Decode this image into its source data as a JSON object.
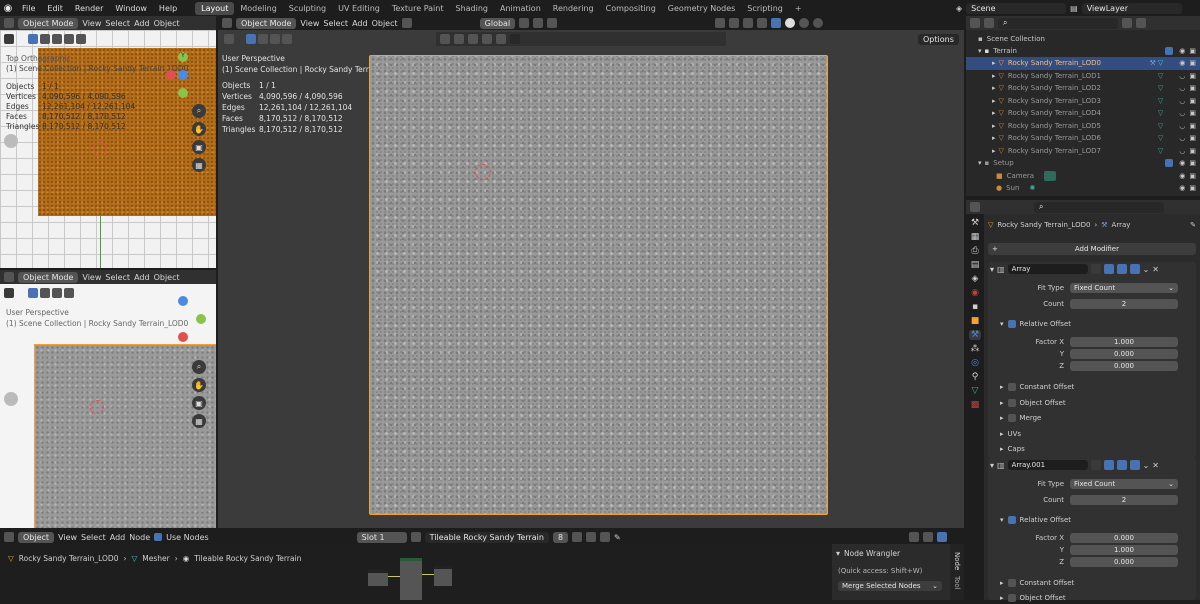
{
  "menu": {
    "items": [
      "File",
      "Edit",
      "Render",
      "Window",
      "Help"
    ]
  },
  "workspaces": [
    "Layout",
    "Modeling",
    "Sculpting",
    "UV Editing",
    "Texture Paint",
    "Shading",
    "Animation",
    "Rendering",
    "Compositing",
    "Geometry Nodes",
    "Scripting"
  ],
  "active_workspace": "Layout",
  "top_right": {
    "scene": "Scene",
    "view_layer": "ViewLayer"
  },
  "left_top": {
    "mode": "Object Mode",
    "menus": [
      "View",
      "Select",
      "Add",
      "Object"
    ],
    "overlay_title": "Top Orthographic",
    "overlay_collection": "(1) Scene Collection | Rocky Sandy Terrain_LOD0",
    "stats": [
      [
        "Objects",
        "1 / 1"
      ],
      [
        "Vertices",
        "4,090,596 / 4,090,596"
      ],
      [
        "Edges",
        "12,261,104 / 12,261,104"
      ],
      [
        "Faces",
        "8,170,512 / 8,170,512"
      ],
      [
        "Triangles",
        "8,170,512 / 8,170,512"
      ]
    ]
  },
  "left_bottom": {
    "mode": "Object Mode",
    "menus": [
      "View",
      "Select",
      "Add",
      "Object"
    ],
    "overlay_title": "User Perspective",
    "overlay_collection": "(1) Scene Collection | Rocky Sandy Terrain_LOD0"
  },
  "main_vp": {
    "mode": "Object Mode",
    "menus": [
      "View",
      "Select",
      "Add",
      "Object"
    ],
    "orientation": "Global",
    "overlay_title": "User Perspective",
    "overlay_collection": "(1) Scene Collection | Rocky Sandy Terrain_LOD0",
    "stats": [
      [
        "Objects",
        "1 / 1"
      ],
      [
        "Vertices",
        "4,090,596 / 4,090,596"
      ],
      [
        "Edges",
        "12,261,104 / 12,261,104"
      ],
      [
        "Faces",
        "8,170,512 / 8,170,512"
      ],
      [
        "Triangles",
        "8,170,512 / 8,170,512"
      ]
    ],
    "options_label": "Options"
  },
  "outliner": {
    "root": "Scene Collection",
    "terrain": "Terrain",
    "lods": [
      "Rocky Sandy Terrain_LOD0",
      "Rocky Sandy Terrain_LOD1",
      "Rocky Sandy Terrain_LOD2",
      "Rocky Sandy Terrain_LOD3",
      "Rocky Sandy Terrain_LOD4",
      "Rocky Sandy Terrain_LOD5",
      "Rocky Sandy Terrain_LOD6",
      "Rocky Sandy Terrain_LOD7"
    ],
    "setup": "Setup",
    "camera": "Camera",
    "sun": "Sun"
  },
  "properties": {
    "object_name": "Rocky Sandy Terrain_LOD0",
    "modifier_crumb": "Array",
    "add_modifier": "Add Modifier",
    "mod1": {
      "name": "Array",
      "fit_type_label": "Fit Type",
      "fit_type": "Fixed Count",
      "count_label": "Count",
      "count": "2",
      "relative_offset": "Relative Offset",
      "factor_x_label": "Factor X",
      "factor_x": "1.000",
      "y_label": "Y",
      "y": "0.000",
      "z_label": "Z",
      "z": "0.000",
      "constant_offset": "Constant Offset",
      "object_offset": "Object Offset",
      "merge": "Merge",
      "uvs": "UVs",
      "caps": "Caps"
    },
    "mod2": {
      "name": "Array.001",
      "fit_type_label": "Fit Type",
      "fit_type": "Fixed Count",
      "count_label": "Count",
      "count": "2",
      "relative_offset": "Relative Offset",
      "factor_x_label": "Factor X",
      "factor_x": "0.000",
      "y_label": "Y",
      "y": "1.000",
      "z_label": "Z",
      "z": "0.000",
      "constant_offset": "Constant Offset",
      "object_offset": "Object Offset"
    }
  },
  "node_editor": {
    "object_mode": "Object",
    "menus": [
      "View",
      "Select",
      "Add",
      "Node"
    ],
    "use_nodes": "Use Nodes",
    "slot": "Slot 1",
    "material": "Tileable Rocky Sandy Terrain",
    "users": "8",
    "breadcrumb": [
      "Rocky Sandy Terrain_LOD0",
      "Mesher",
      "Tileable Rocky Sandy Terrain"
    ],
    "wrangler_title": "Node Wrangler",
    "wrangler_hint": "(Quick access: Shift+W)",
    "wrangler_btn": "Merge Selected Nodes",
    "side_tabs": [
      "Node",
      "Tool"
    ]
  },
  "colors": {
    "accent": "#4772b3",
    "selection": "#f5a032",
    "terrain_top": "#b06a18",
    "terrain_grey": "#9a9a9a",
    "bg": "#1d1d1d"
  }
}
